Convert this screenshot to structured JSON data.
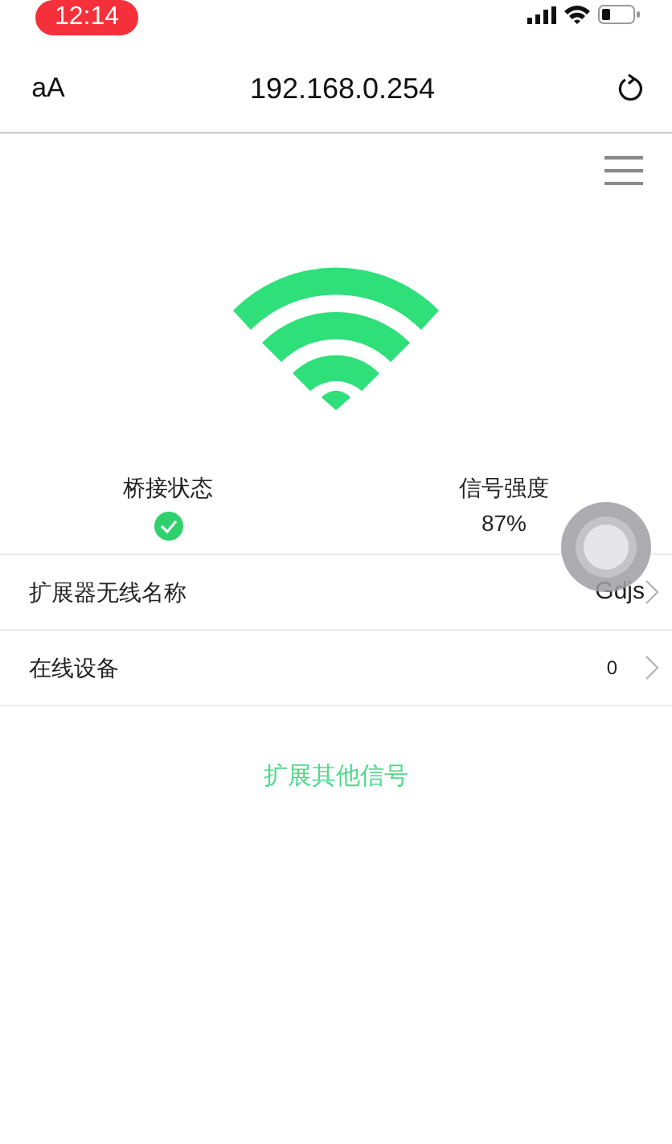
{
  "status_bar": {
    "time": "12:14"
  },
  "browser": {
    "text_size_button": "aA",
    "url": "192.168.0.254"
  },
  "status": [
    {
      "kind": "check",
      "label": "桥接状态",
      "connected": true
    },
    {
      "kind": "text",
      "label": "信号强度",
      "value": "87%"
    }
  ],
  "rows": [
    {
      "label": "扩展器无线名称",
      "value": "Gdjs"
    },
    {
      "label": "在线设备",
      "value": "0"
    }
  ],
  "link": "扩展其他信号"
}
